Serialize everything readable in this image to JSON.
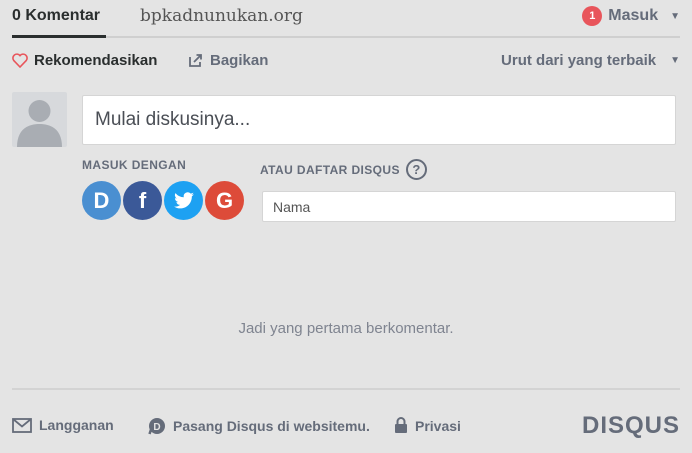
{
  "header": {
    "comments_tab": "0 Komentar",
    "site_name": "bpkadnunukan.org",
    "notification_count": "1",
    "login_label": "Masuk"
  },
  "actions": {
    "recommend_label": "Rekomendasikan",
    "share_label": "Bagikan",
    "sort_label": "Urut dari yang terbaik"
  },
  "composer": {
    "placeholder": "Mulai diskusinya..."
  },
  "login": {
    "heading": "MASUK DENGAN",
    "providers": [
      {
        "name": "disqus-login-button",
        "glyph": "D",
        "color": "#4a8fd1"
      },
      {
        "name": "facebook-login-button",
        "glyph": "f",
        "color": "#3b5998"
      },
      {
        "name": "twitter-login-button",
        "glyph": "t",
        "color": "#1da1f2"
      },
      {
        "name": "google-login-button",
        "glyph": "G",
        "color": "#dd4b39"
      }
    ]
  },
  "register": {
    "heading": "ATAU DAFTAR DISQUS",
    "help_glyph": "?",
    "name_placeholder": "Nama"
  },
  "empty_state": "Jadi yang pertama berkomentar.",
  "footer": {
    "subscribe_label": "Langganan",
    "install_label": "Pasang Disqus di websitemu.",
    "privacy_label": "Privasi",
    "brand": "DISQUS"
  },
  "colors": {
    "background": "#e4e4e4",
    "badge": "#e8555b",
    "muted_text": "#656c7a"
  }
}
